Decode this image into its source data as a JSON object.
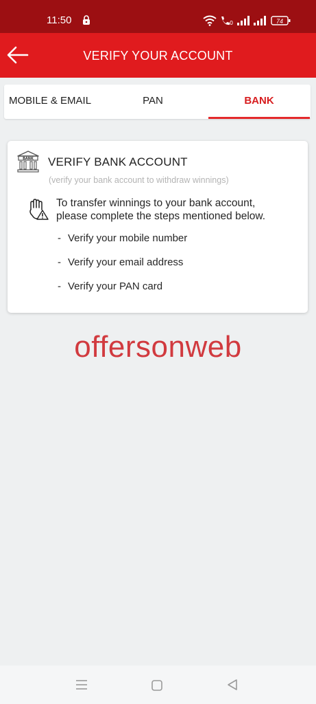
{
  "status_bar": {
    "time": "11:50",
    "battery": "74",
    "background_color": "#9c0f12"
  },
  "header": {
    "title": "VERIFY YOUR ACCOUNT",
    "back_icon": "back-arrow-icon",
    "background_color": "#e01b1e"
  },
  "tabs": [
    {
      "label": "MOBILE & EMAIL",
      "selected": false
    },
    {
      "label": "PAN",
      "selected": false
    },
    {
      "label": "BANK",
      "selected": true
    }
  ],
  "card": {
    "icon": "bank-icon",
    "icon_label": "BANK",
    "title": "VERIFY BANK ACCOUNT",
    "subtitle": "(verify your bank account to withdraw winnings)",
    "hand_icon": "hand-warning-icon",
    "instruction_line1": "To transfer winnings to your bank account,",
    "instruction_line2": "please complete the steps mentioned below.",
    "steps": [
      "Verify your mobile number",
      "Verify your email address",
      "Verify your PAN card"
    ]
  },
  "watermark": "offersonweb",
  "accent_color": "#e4292b",
  "nav_bar": {
    "icons": [
      "menu-icon",
      "home-square-icon",
      "back-triangle-icon"
    ]
  }
}
